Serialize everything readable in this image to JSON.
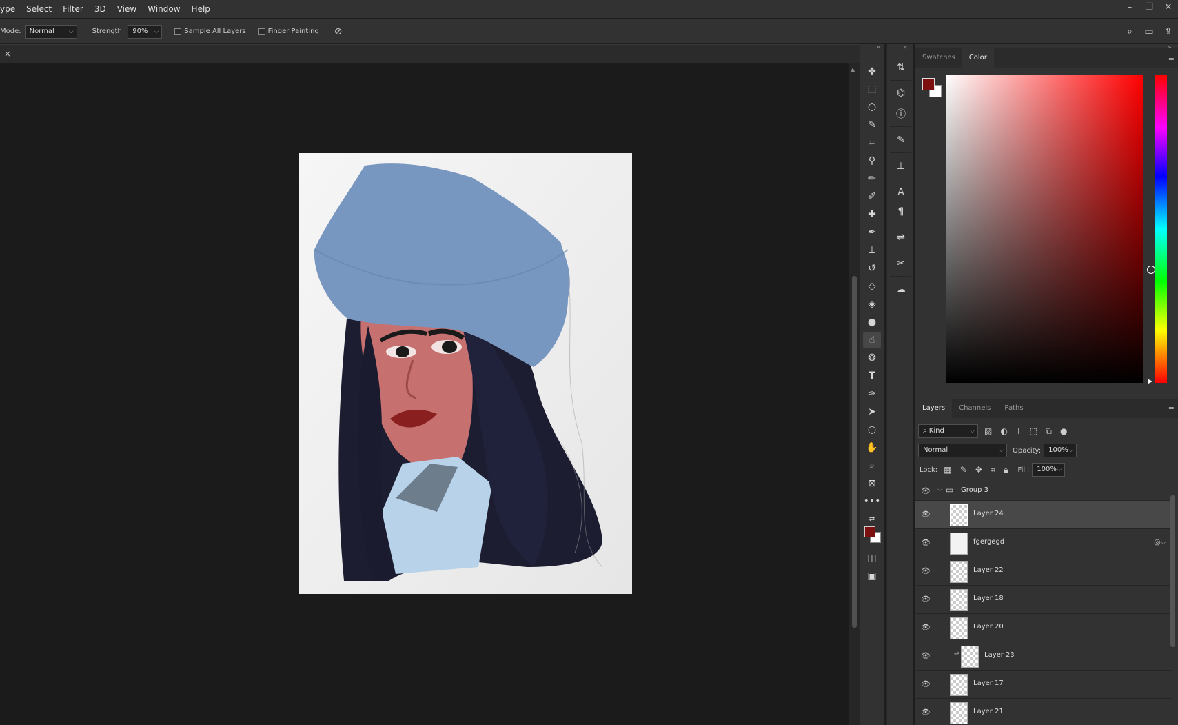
{
  "menubar": {
    "items": [
      "ype",
      "Select",
      "Filter",
      "3D",
      "View",
      "Window",
      "Help"
    ],
    "window_controls": {
      "minimize": "–",
      "restore": "❐",
      "close": "✕"
    }
  },
  "options": {
    "mode_label": "Mode:",
    "mode_value": "Normal",
    "strength_label": "Strength:",
    "strength_value": "90%",
    "sample_all_layers": "Sample All Layers",
    "finger_painting": "Finger Painting"
  },
  "document": {
    "close": "×"
  },
  "color_panel": {
    "tabs": [
      "Swatches",
      "Color"
    ],
    "active_tab": "Color",
    "foreground": "#7c1010",
    "background": "#ffffff"
  },
  "layers_panel": {
    "tabs": [
      "Layers",
      "Channels",
      "Paths"
    ],
    "filter_kind": "Kind",
    "blend_mode": "Normal",
    "opacity_label": "Opacity:",
    "opacity_value": "100%",
    "lock_label": "Lock:",
    "fill_label": "Fill:",
    "fill_value": "100%",
    "group": "Group 3",
    "layers": [
      "Layer 24",
      "fgergegd",
      "Layer 22",
      "Layer 18",
      "Layer 20",
      "Layer 23",
      "Layer 17",
      "Layer 21"
    ],
    "selected_layer": "Layer 24"
  },
  "tools": {
    "icons": [
      "move-icon",
      "marquee-icon",
      "lasso-icon",
      "quick-select-icon",
      "crop-icon",
      "eyedropper-icon",
      "brush-icon",
      "pencil-icon",
      "healing-icon",
      "mixer-brush-icon",
      "stamp-icon",
      "history-brush-icon",
      "eraser-icon",
      "bucket-icon",
      "blur-icon",
      "smudge-icon",
      "sponge-icon",
      "type-icon",
      "pen-icon",
      "path-select-icon",
      "ellipse-icon",
      "hand-icon",
      "zoom-icon",
      "frame-icon",
      "more-icon"
    ],
    "active": "smudge-icon"
  }
}
